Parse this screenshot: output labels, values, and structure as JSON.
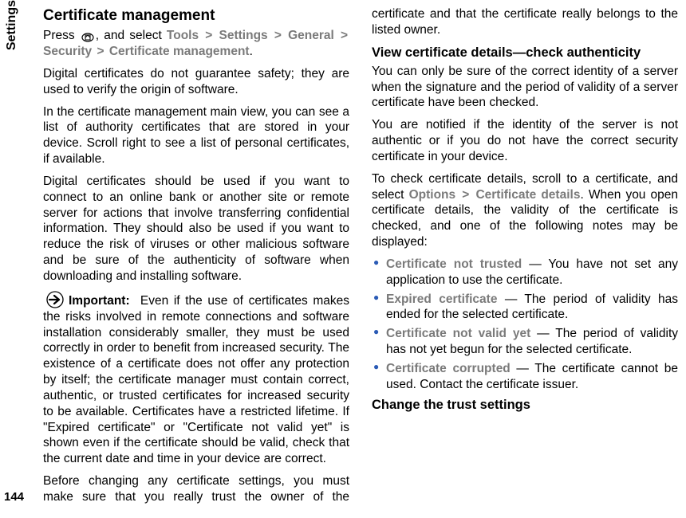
{
  "sideTab": "Settings",
  "pageNumber": "144",
  "heading": "Certificate management",
  "pressIntro": {
    "pre": "Press ",
    "post": ", and select ",
    "path": [
      "Tools",
      "Settings",
      "General",
      "Security",
      "Certificate management"
    ]
  },
  "para1": "Digital certificates do not guarantee safety; they are used to verify the origin of software.",
  "para2": "In the certificate management main view, you can see a list of authority certificates that are stored in your device. Scroll right to see a list of personal certificates, if available.",
  "para3": "Digital certificates should be used if you want to connect to an online bank or another site or remote server for actions that involve transferring confidential information. They should also be used if you want to reduce the risk of viruses or other malicious software and be sure of the authenticity of software when downloading and installing software.",
  "importantLabel": "Important:",
  "importantText": "Even if the use of certificates makes the risks involved in remote connections and software installation considerably smaller, they must be used correctly in order to benefit from increased security. The existence of a certificate does not offer any protection by itself; the certificate manager must contain correct, authentic, or trusted certificates for increased security to be available. Certificates have a restricted lifetime. If \"Expired certificate\" or \"Certificate not valid yet\" is shown even if the certificate should be valid, check that the current date and time in your device are correct.",
  "para4": "Before changing any certificate settings, you must make sure that you really trust the owner of the certificate and that the certificate really belongs to the listed owner.",
  "subheading1": "View certificate details—check authenticity",
  "para5": "You can only be sure of the correct identity of a server when the signature and the period of validity of a server certificate have been checked.",
  "para6": "You are notified if the identity of the server is not authentic or if you do not have the correct security certificate in your device.",
  "para7a": "To check certificate details, scroll to a certificate, and select ",
  "para7path": [
    "Options",
    "Certificate details"
  ],
  "para7b": ". When you open certificate details, the validity of the certificate is checked, and one of the following notes may be displayed:",
  "bullets": [
    {
      "term": "Certificate not trusted",
      "rest": " — You have not set any application to use the certificate."
    },
    {
      "term": "Expired certificate",
      "rest": " — The period of validity has ended for the selected certificate."
    },
    {
      "term": "Certificate not valid yet",
      "rest": " — The period of validity has not yet begun for the selected certificate."
    },
    {
      "term": "Certificate corrupted",
      "rest": " — The certificate cannot be used. Contact the certificate issuer."
    }
  ],
  "subheading2": "Change the trust settings"
}
